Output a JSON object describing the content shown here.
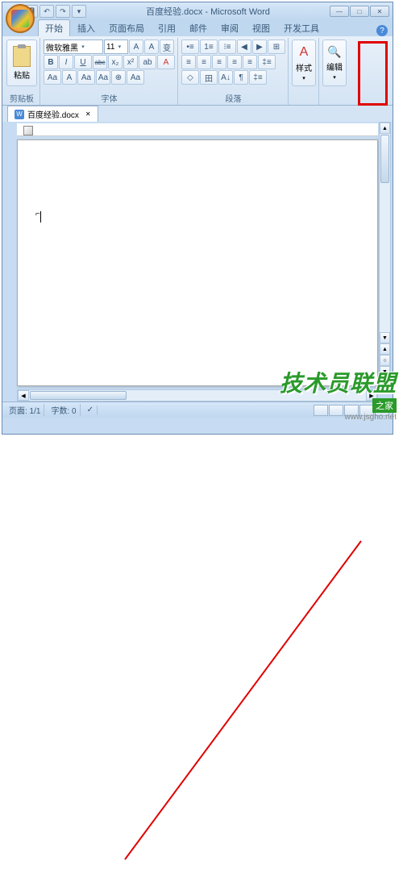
{
  "title": "百度经验.docx - Microsoft Word",
  "qat": {
    "save": "💾",
    "undo": "↶",
    "redo": "↷",
    "more": "▾"
  },
  "win": {
    "min": "—",
    "max": "□",
    "close": "✕"
  },
  "tabs": [
    "开始",
    "插入",
    "页面布局",
    "引用",
    "邮件",
    "审阅",
    "视图",
    "开发工具"
  ],
  "active_tab": 0,
  "help": "?",
  "groups": {
    "clipboard": {
      "label": "剪贴板",
      "paste": "粘贴"
    },
    "font": {
      "label": "字体",
      "name": "微软雅黑",
      "size": "11",
      "grow": "A",
      "shrink": "A",
      "clear": "Aa",
      "bold": "B",
      "italic": "I",
      "underline": "U",
      "strike": "abc",
      "sub": "x₂",
      "sup": "x²",
      "case": "Aa",
      "highlight": "ab",
      "color": "A",
      "phonetic": "⊕",
      "border": "A",
      "wen": "变"
    },
    "paragraph": {
      "label": "段落",
      "bullets": "•≡",
      "numbers": "1≡",
      "multi": "⁝≡",
      "indent_dec": "◀",
      "indent_inc": "▶",
      "align_l": "≡",
      "align_c": "≡",
      "align_r": "≡",
      "align_j": "≡",
      "distrib": "≡",
      "spacing": "‡≡",
      "shading": "◇",
      "borders": "田",
      "sort": "A↓",
      "marks": "¶",
      "snap": "⊞"
    },
    "styles": {
      "label": "样式",
      "btn": "A"
    },
    "editing": {
      "label": "编辑",
      "icon": "🔍"
    }
  },
  "doc_tab": "百度经验.docx",
  "status": {
    "page": "页面: 1/1",
    "words": "字数: 0",
    "lang": "✓"
  },
  "watermark": {
    "main": "技术员联盟",
    "sub": "之家",
    "url": "www.jsgho.net"
  }
}
